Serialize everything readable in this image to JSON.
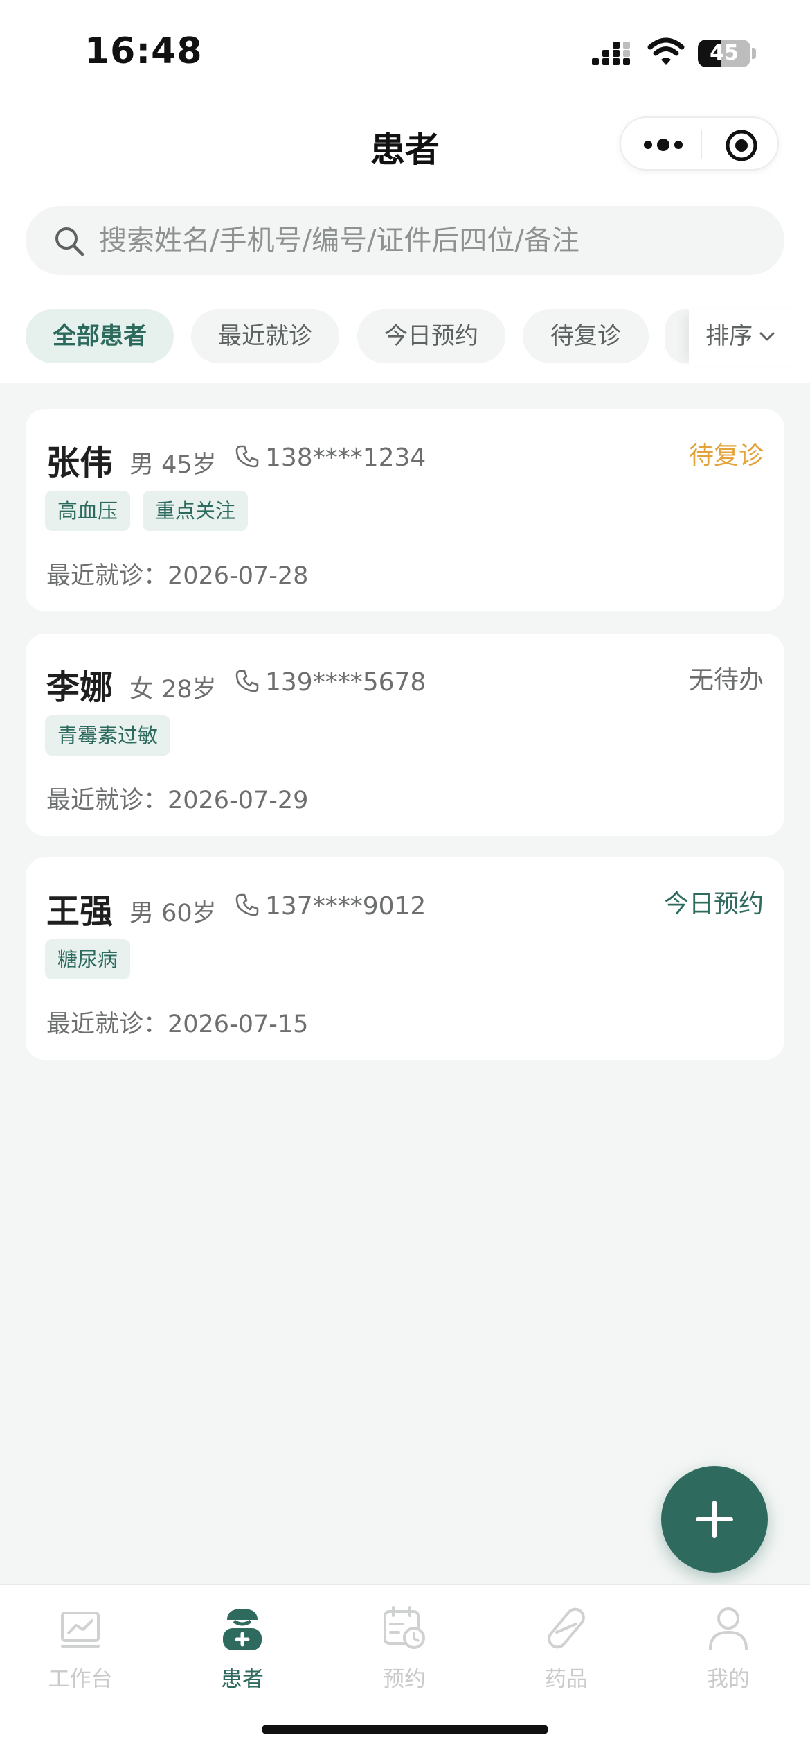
{
  "status_bar": {
    "time": "16:48",
    "battery_level": "45",
    "battery_percent": 45,
    "icons": [
      "signal-icon",
      "wifi-icon",
      "battery-icon"
    ]
  },
  "nav": {
    "title": "患者",
    "capsule_icons": [
      "more-icon",
      "target-icon"
    ]
  },
  "search": {
    "placeholder": "搜索姓名/手机号/编号/证件后四位/备注",
    "value": ""
  },
  "filters": {
    "chips": [
      "全部患者",
      "最近就诊",
      "今日预约",
      "待复诊"
    ],
    "selected": "全部患者",
    "sort_label": "排序"
  },
  "patients": [
    {
      "name": "张伟",
      "meta": "男 45岁",
      "phone": "138****1234",
      "status": "待复诊",
      "status_color": "#e3a23a",
      "tags": [
        "高血压",
        "重点关注"
      ],
      "last_visit": "最近就诊：2026-07-28"
    },
    {
      "name": "李娜",
      "meta": "女 28岁",
      "phone": "139****5678",
      "status": "无待办",
      "status_color": "#6c6f6e",
      "tags": [
        "青霉素过敏"
      ],
      "last_visit": "最近就诊：2026-07-29"
    },
    {
      "name": "王强",
      "meta": "男 60岁",
      "phone": "137****9012",
      "status": "今日预约",
      "status_color": "#2f6a5e",
      "tags": [
        "糖尿病"
      ],
      "last_visit": "最近就诊：2026-07-15"
    }
  ],
  "fab": {
    "icon": "plus-icon"
  },
  "tabbar": {
    "tabs": [
      {
        "label": "工作台",
        "icon": "chart-icon"
      },
      {
        "label": "患者",
        "icon": "patient-icon"
      },
      {
        "label": "预约",
        "icon": "calendar-icon"
      },
      {
        "label": "药品",
        "icon": "pill-icon"
      },
      {
        "label": "我的",
        "icon": "user-icon"
      }
    ],
    "active": "患者"
  },
  "colors": {
    "accent": "#2f6a5e",
    "chip_active_bg": "#e6f0ed",
    "background": "#f4f6f5",
    "status_pending": "#e3a23a"
  }
}
